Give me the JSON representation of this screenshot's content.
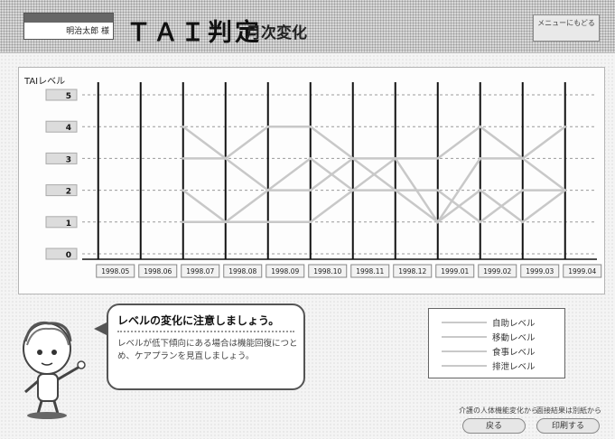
{
  "header": {
    "user_name": "明治太郎 様",
    "title": "ＴＡＩ判定",
    "subtitle": "月次変化",
    "return_button": "メニューにもどる"
  },
  "advice": {
    "title": "レベルの変化に注意しましょう。",
    "body": "レベルが低下傾向にある場合は機能回復につとめ、ケアプランを見直しましょう。"
  },
  "legend": [
    "自助レベル",
    "移動レベル",
    "食事レベル",
    "排泄レベル"
  ],
  "footer": {
    "label_left": "介護の人体機能変化から",
    "label_right": "面接結果は別紙から",
    "button_back": "戻る",
    "button_print": "印刷する"
  },
  "colors": {
    "series": "#c8c8c8",
    "axis": "#111111"
  },
  "chart_data": {
    "type": "line",
    "ylabel": "TAIレベル",
    "ylim": [
      0,
      5
    ],
    "y_ticks": [
      0,
      1,
      2,
      3,
      4,
      5
    ],
    "categories": [
      "1998.05",
      "1998.06",
      "1998.07",
      "1998.08",
      "1998.09",
      "1998.10",
      "1998.11",
      "1998.12",
      "1999.01",
      "1999.02",
      "1999.03",
      "1999.04"
    ],
    "series": [
      {
        "name": "自助レベル",
        "values": [
          null,
          null,
          4,
          3,
          4,
          4,
          3,
          3,
          3,
          4,
          3,
          4
        ]
      },
      {
        "name": "移動レベル",
        "values": [
          null,
          null,
          3,
          3,
          2,
          3,
          2,
          3,
          1,
          3,
          3,
          2
        ]
      },
      {
        "name": "食事レベル",
        "values": [
          null,
          null,
          2,
          1,
          2,
          2,
          3,
          2,
          2,
          1,
          2,
          2
        ]
      },
      {
        "name": "排泄レベル",
        "values": [
          null,
          null,
          1,
          1,
          1,
          1,
          2,
          2,
          1,
          2,
          1,
          2
        ]
      }
    ]
  }
}
